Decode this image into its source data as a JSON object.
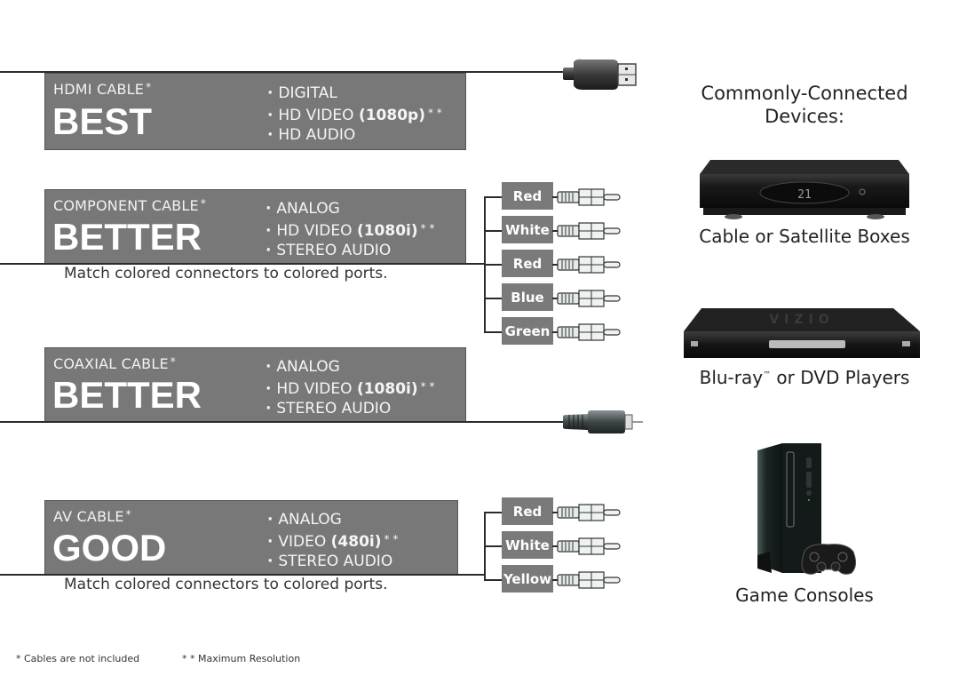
{
  "cables": [
    {
      "name": "HDMI CABLE",
      "marker": "*",
      "rating": "BEST",
      "features": [
        {
          "text": "DIGITAL"
        },
        {
          "text": "HD VIDEO ",
          "bold": "(1080p)",
          "suffix": "* *"
        },
        {
          "text": "HD AUDIO"
        }
      ],
      "connector": "hdmi-plug"
    },
    {
      "name": "COMPONENT CABLE",
      "marker": "*",
      "rating": "BETTER",
      "features": [
        {
          "text": "ANALOG"
        },
        {
          "text": "HD VIDEO ",
          "bold": "(1080i)",
          "suffix": "* *"
        },
        {
          "text": "STEREO AUDIO"
        }
      ],
      "note": "Match colored connectors to colored ports.",
      "plugs": [
        "Red",
        "White",
        "Red",
        "Blue",
        "Green"
      ],
      "connector": "rca-plug"
    },
    {
      "name": "COAXIAL CABLE",
      "marker": "*",
      "rating": "BETTER",
      "features": [
        {
          "text": "ANALOG"
        },
        {
          "text": "HD VIDEO ",
          "bold": "(1080i)",
          "suffix": "* *"
        },
        {
          "text": "STEREO AUDIO"
        }
      ],
      "connector": "coaxial-plug"
    },
    {
      "name": "AV CABLE",
      "marker": "*",
      "rating": "GOOD",
      "features": [
        {
          "text": "ANALOG"
        },
        {
          "text": "VIDEO ",
          "bold": "(480i)",
          "suffix": "* *"
        },
        {
          "text": "STEREO AUDIO"
        }
      ],
      "note": "Match colored connectors to colored ports.",
      "plugs": [
        "Red",
        "White",
        "Yellow"
      ],
      "connector": "rca-plug"
    }
  ],
  "devices": {
    "title_line1": "Commonly-Connected",
    "title_line2": "Devices:",
    "items": [
      {
        "label": "Cable or Satellite Boxes",
        "display": "21"
      },
      {
        "label_main": "Blu-ray",
        "label_tm": "™",
        "label_rest": " or DVD Players",
        "brand": "VIZIO"
      },
      {
        "label": "Game Consoles"
      }
    ]
  },
  "footnotes": {
    "cables": "* Cables are not included",
    "resolution": "* * Maximum Resolution"
  },
  "colors": {
    "panel": "#787878",
    "line": "#2b2b2b",
    "tag": "#7a7a7a"
  }
}
